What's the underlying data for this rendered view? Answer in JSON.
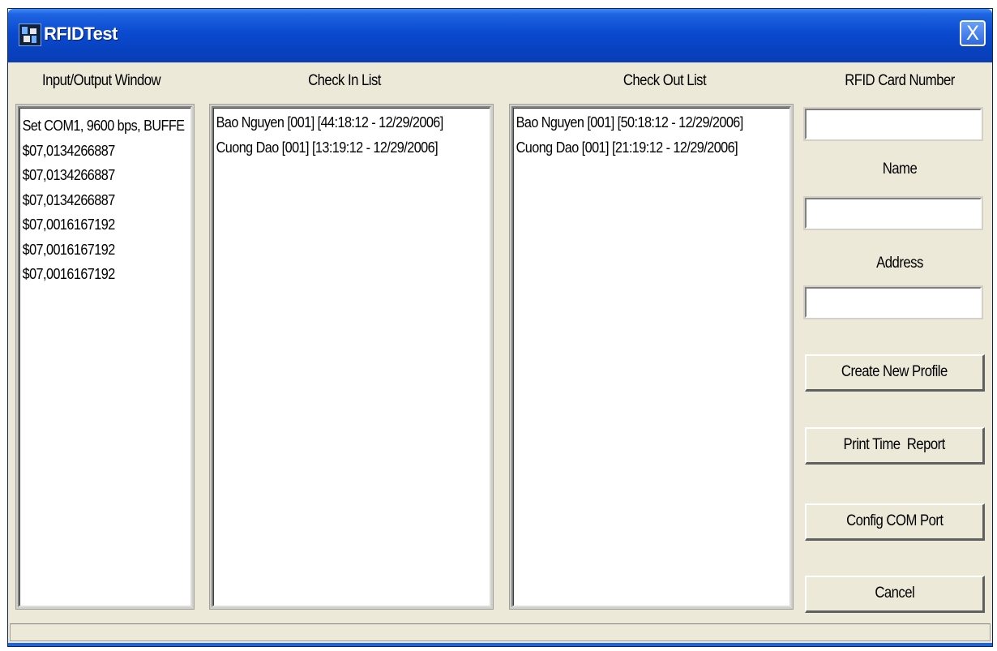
{
  "window": {
    "title": "RFIDTest",
    "close_label": "X"
  },
  "labels": {
    "io_window": "Input/Output Window",
    "check_in": "Check In List",
    "check_out": "Check Out List",
    "card_number": "RFID Card Number",
    "name": "Name",
    "address": "Address"
  },
  "io_lines": [
    "Set COM1, 9600 bps, BUFFE",
    "$07,0134266887",
    "$07,0134266887",
    "$07,0134266887",
    "$07,0016167192",
    "$07,0016167192",
    "$07,0016167192"
  ],
  "check_in_items": [
    "Bao Nguyen [001] [44:18:12 - 12/29/2006]",
    "Cuong Dao [001] [13:19:12 - 12/29/2006]"
  ],
  "check_out_items": [
    "Bao Nguyen [001] [50:18:12 - 12/29/2006]",
    "Cuong Dao [001] [21:19:12 - 12/29/2006]"
  ],
  "fields": {
    "card_number_value": "",
    "name_value": "",
    "address_value": ""
  },
  "buttons": {
    "create_profile": "Create New Profile",
    "print_report": "Print Time  Report",
    "config_com": "Config COM Port",
    "cancel": "Cancel"
  },
  "colors": {
    "titlebar": "#0a4ad0",
    "window_bg": "#ece9d8"
  }
}
